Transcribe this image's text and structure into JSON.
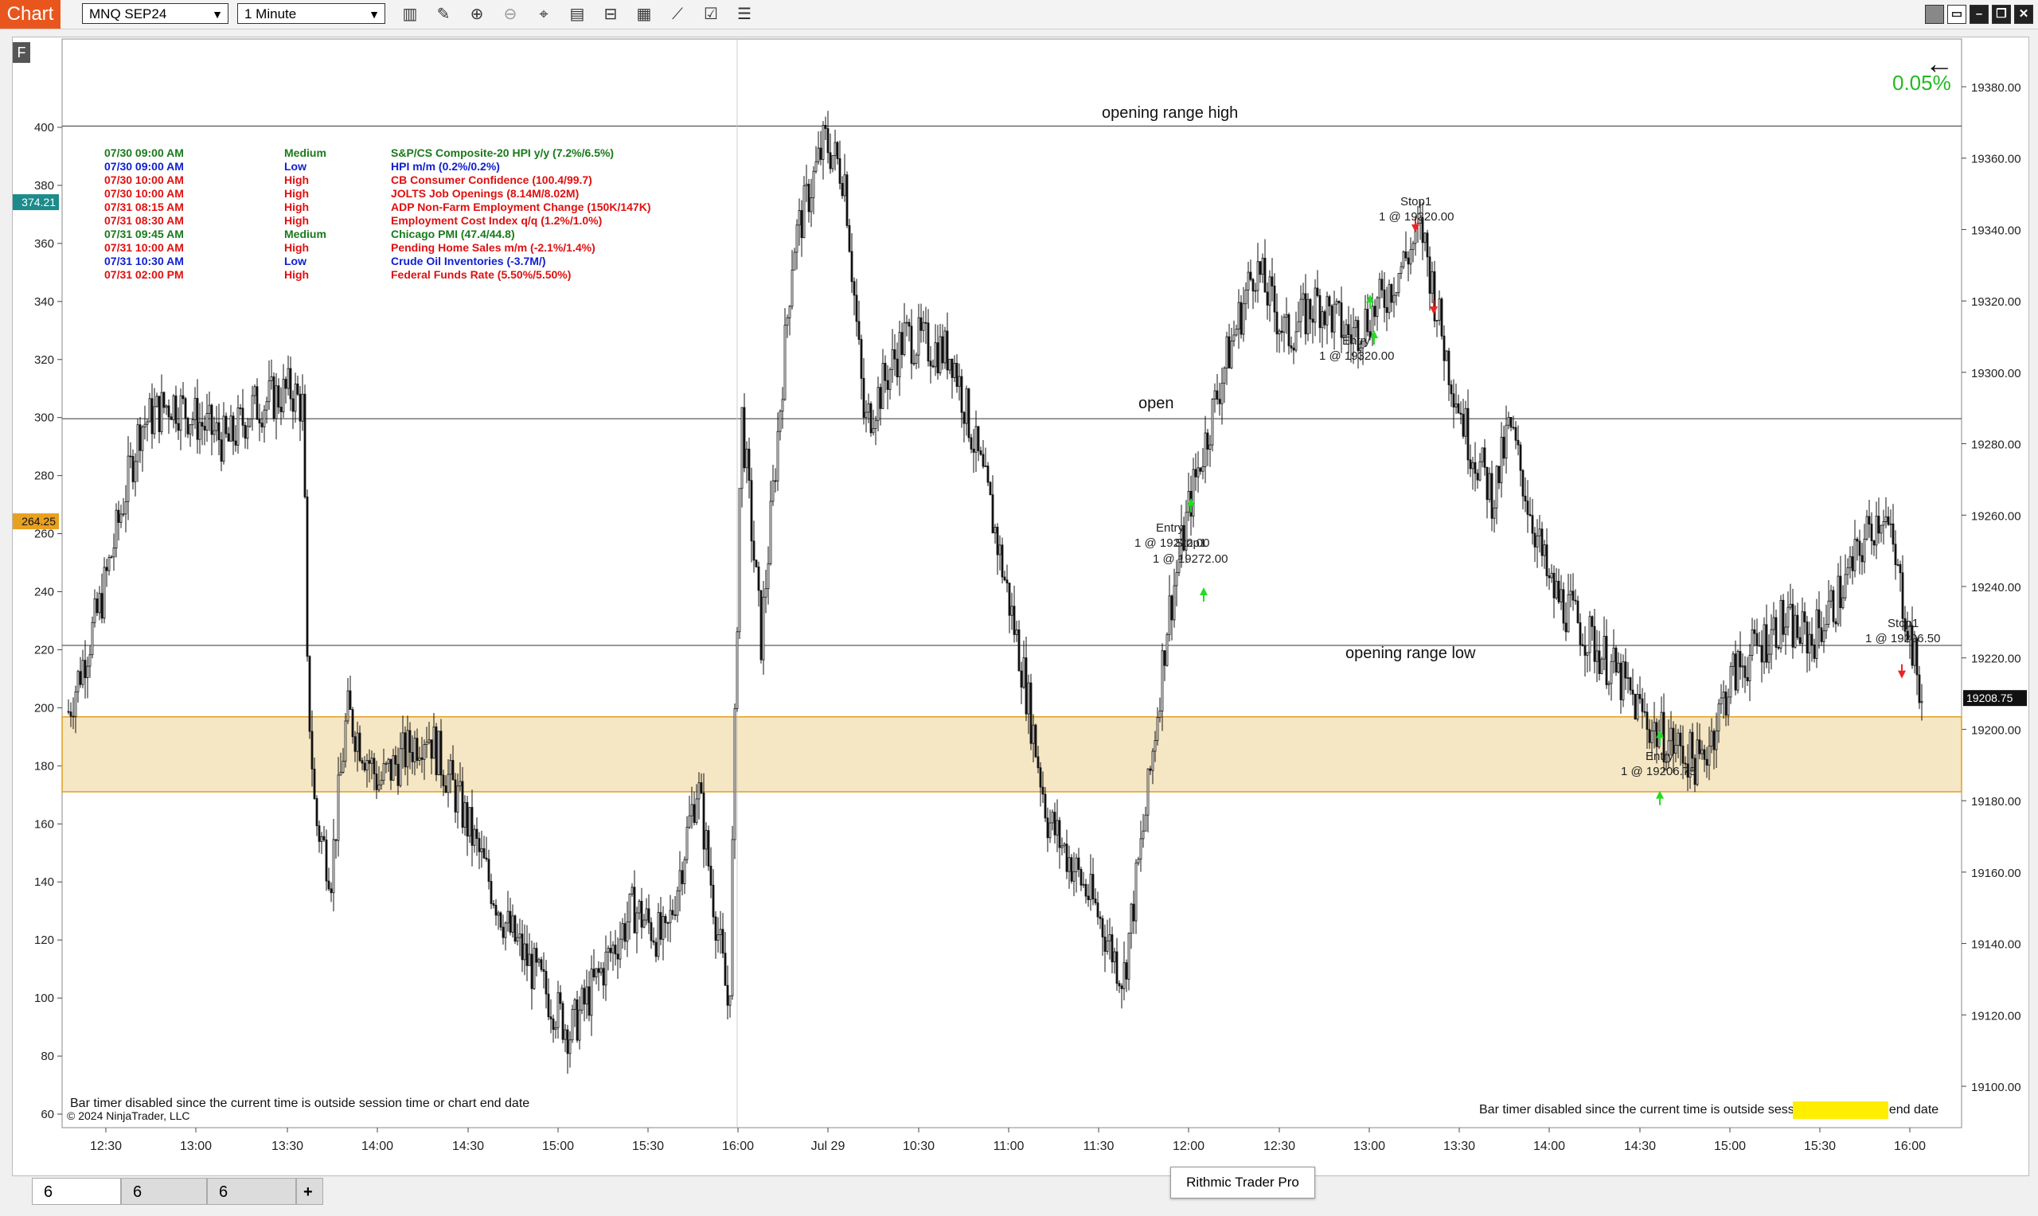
{
  "window": {
    "tab_label": "Chart",
    "instrument": "MNQ SEP24",
    "timeframe": "1 Minute",
    "f_badge": "F"
  },
  "left_axis": {
    "ticks": [
      "400",
      "380",
      "360",
      "340",
      "320",
      "300",
      "280",
      "260",
      "240",
      "220",
      "200",
      "180",
      "160",
      "140",
      "120",
      "100",
      "80",
      "60"
    ],
    "marker_top": "374.21",
    "marker_bottom": "264.25"
  },
  "right_axis": {
    "ticks": [
      "19380.00",
      "19360.00",
      "19340.00",
      "19320.00",
      "19300.00",
      "19280.00",
      "19260.00",
      "19240.00",
      "19220.00",
      "19200.00",
      "19180.00",
      "19160.00",
      "19140.00",
      "19120.00",
      "19100.00"
    ],
    "last_price": "19208.75"
  },
  "x_axis": {
    "ticks": [
      "12:30",
      "13:00",
      "13:30",
      "14:00",
      "14:30",
      "15:00",
      "15:30",
      "16:00",
      "Jul 29",
      "10:30",
      "11:00",
      "11:30",
      "12:00",
      "12:30",
      "13:00",
      "13:30",
      "14:00",
      "14:30",
      "15:00",
      "15:30",
      "16:00"
    ]
  },
  "percent_change": "0.05%",
  "back_arrow": "←",
  "lines": {
    "opening_range_high": "opening range high",
    "open": "open",
    "opening_range_low": "opening range low"
  },
  "news": [
    {
      "time": "07/30 09:00 AM",
      "impact": "Medium",
      "event": "S&P/CS Composite-20 HPI y/y (7.2%/6.5%)",
      "color": "#1a7a1a"
    },
    {
      "time": "07/30 09:00 AM",
      "impact": "Low",
      "event": "HPI m/m (0.2%/0.2%)",
      "color": "#1020d0"
    },
    {
      "time": "07/30 10:00 AM",
      "impact": "High",
      "event": "CB Consumer Confidence (100.4/99.7)",
      "color": "#e01010"
    },
    {
      "time": "07/30 10:00 AM",
      "impact": "High",
      "event": "JOLTS Job Openings (8.14M/8.02M)",
      "color": "#e01010"
    },
    {
      "time": "07/31 08:15 AM",
      "impact": "High",
      "event": "ADP Non-Farm Employment Change (150K/147K)",
      "color": "#e01010"
    },
    {
      "time": "07/31 08:30 AM",
      "impact": "High",
      "event": "Employment Cost Index q/q (1.2%/1.0%)",
      "color": "#e01010"
    },
    {
      "time": "07/31 09:45 AM",
      "impact": "Medium",
      "event": "Chicago PMI (47.4/44.8)",
      "color": "#1a7a1a"
    },
    {
      "time": "07/31 10:00 AM",
      "impact": "High",
      "event": "Pending Home Sales m/m (-2.1%/1.4%)",
      "color": "#e01010"
    },
    {
      "time": "07/31 10:30 AM",
      "impact": "Low",
      "event": "Crude Oil Inventories (-3.7M/)",
      "color": "#1020d0"
    },
    {
      "time": "07/31 02:00 PM",
      "impact": "High",
      "event": "Federal Funds Rate (5.50%/5.50%)",
      "color": "#e01010"
    }
  ],
  "trades": [
    {
      "name": "Entry",
      "text": "1 @ 19272.00"
    },
    {
      "name": "Stop1",
      "text": "1 @ 19272.00"
    },
    {
      "name": "Stop1",
      "text": "1 @ 19320.00"
    },
    {
      "name": "Entry",
      "text": "1 @ 19320.00"
    },
    {
      "name": "Entry",
      "text": "1 @ 19206.75"
    },
    {
      "name": "Stop1",
      "text": "1 @ 19206.50"
    }
  ],
  "status": {
    "bar_timer_left": "Bar timer disabled since the current time is outside session time or chart end date",
    "copyright": "© 2024 NinjaTrader, LLC",
    "bar_timer_right": "Bar timer disabled since the current time is outside session time or chart end date"
  },
  "bottom_tabs": [
    "6",
    "6",
    "6"
  ],
  "add_tab": "+",
  "tooltip": "Rithmic Trader Pro",
  "colors": {
    "accent": "#e8561e",
    "zone_fill": "#f5e6c4",
    "zone_border": "#e0a020",
    "pct_green": "#22bb22"
  }
}
